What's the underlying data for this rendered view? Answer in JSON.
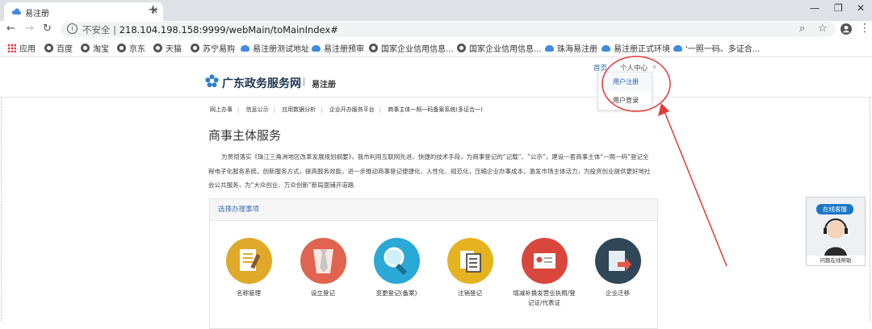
{
  "browser": {
    "tab_title": "易注册",
    "url_security": "不安全",
    "url_sep": "|",
    "url_host": "218.104.198.158:9999/webMain/toMainIndex#",
    "accent": "#1a73e8"
  },
  "bookmarks": [
    {
      "label": "应用",
      "icon": "apps-icon"
    },
    {
      "label": "百度",
      "icon": "globe-icon"
    },
    {
      "label": "淘宝",
      "icon": "globe-icon"
    },
    {
      "label": "京东",
      "icon": "globe-icon"
    },
    {
      "label": "天猫",
      "icon": "globe-icon"
    },
    {
      "label": "苏宁易购",
      "icon": "globe-icon"
    },
    {
      "label": "易注册测试地址",
      "icon": "cloud-icon"
    },
    {
      "label": "易注册预审",
      "icon": "cloud-icon"
    },
    {
      "label": "国家企业信用信息...",
      "icon": "globe-icon"
    },
    {
      "label": "国家企业信用信息...",
      "icon": "globe-icon"
    },
    {
      "label": "珠海易注册",
      "icon": "cloud-icon"
    },
    {
      "label": "易注册正式环境",
      "icon": "cloud-icon"
    },
    {
      "label": "'一照一码、多证合...",
      "icon": "cloud-icon"
    }
  ],
  "header": {
    "logo_text": "广东政务服务网",
    "logo_sub": "易注册",
    "home_link": "首页",
    "user_center": "个人中心",
    "dropdown": [
      "用户注册",
      "用户登录"
    ]
  },
  "breadcrumbs": [
    "网上办事",
    "信息公示",
    "应用数据分析",
    "企业开办服务平台",
    "商事主体一照一码备案系统(多证合一)"
  ],
  "page_title": "商事主体服务",
  "intro": "为贯彻落实《珠江三角洲地区改革发展规划纲要》，我市利用互联网先进、快捷的技术手段，为商事登记的“记载”、“公示”，建设一套商事主体“一照一码”登记全程电子化服务系统，创新服务方式，提高服务效能，进一步推动商事登记便捷化、人性化、规范化，压缩企业办事成本，激发市场主体活力，为投资创业提供更好地社会公共服务，为“大众创业、万众创新”新局面铺开道路",
  "panel_title": "选择办理事项",
  "services": [
    {
      "label": "名称管理",
      "color": "#e0a92a",
      "icon": "notepad-icon"
    },
    {
      "label": "设立登记",
      "color": "#e0644f",
      "icon": "tie-icon"
    },
    {
      "label": "变更登记(备案)",
      "color": "#2aa8d6",
      "icon": "magnifier-icon"
    },
    {
      "label": "注销登记",
      "color": "#e5b31f",
      "icon": "documents-icon"
    },
    {
      "label": "增减补换发营业执照/登记证/代表证",
      "color": "#d9473c",
      "icon": "id-card-icon"
    },
    {
      "label": "企业迁移",
      "color": "#2f4756",
      "icon": "transfer-icon"
    }
  ],
  "customer_service": {
    "badge": "在线客服",
    "caption": "问题在线帮助"
  }
}
